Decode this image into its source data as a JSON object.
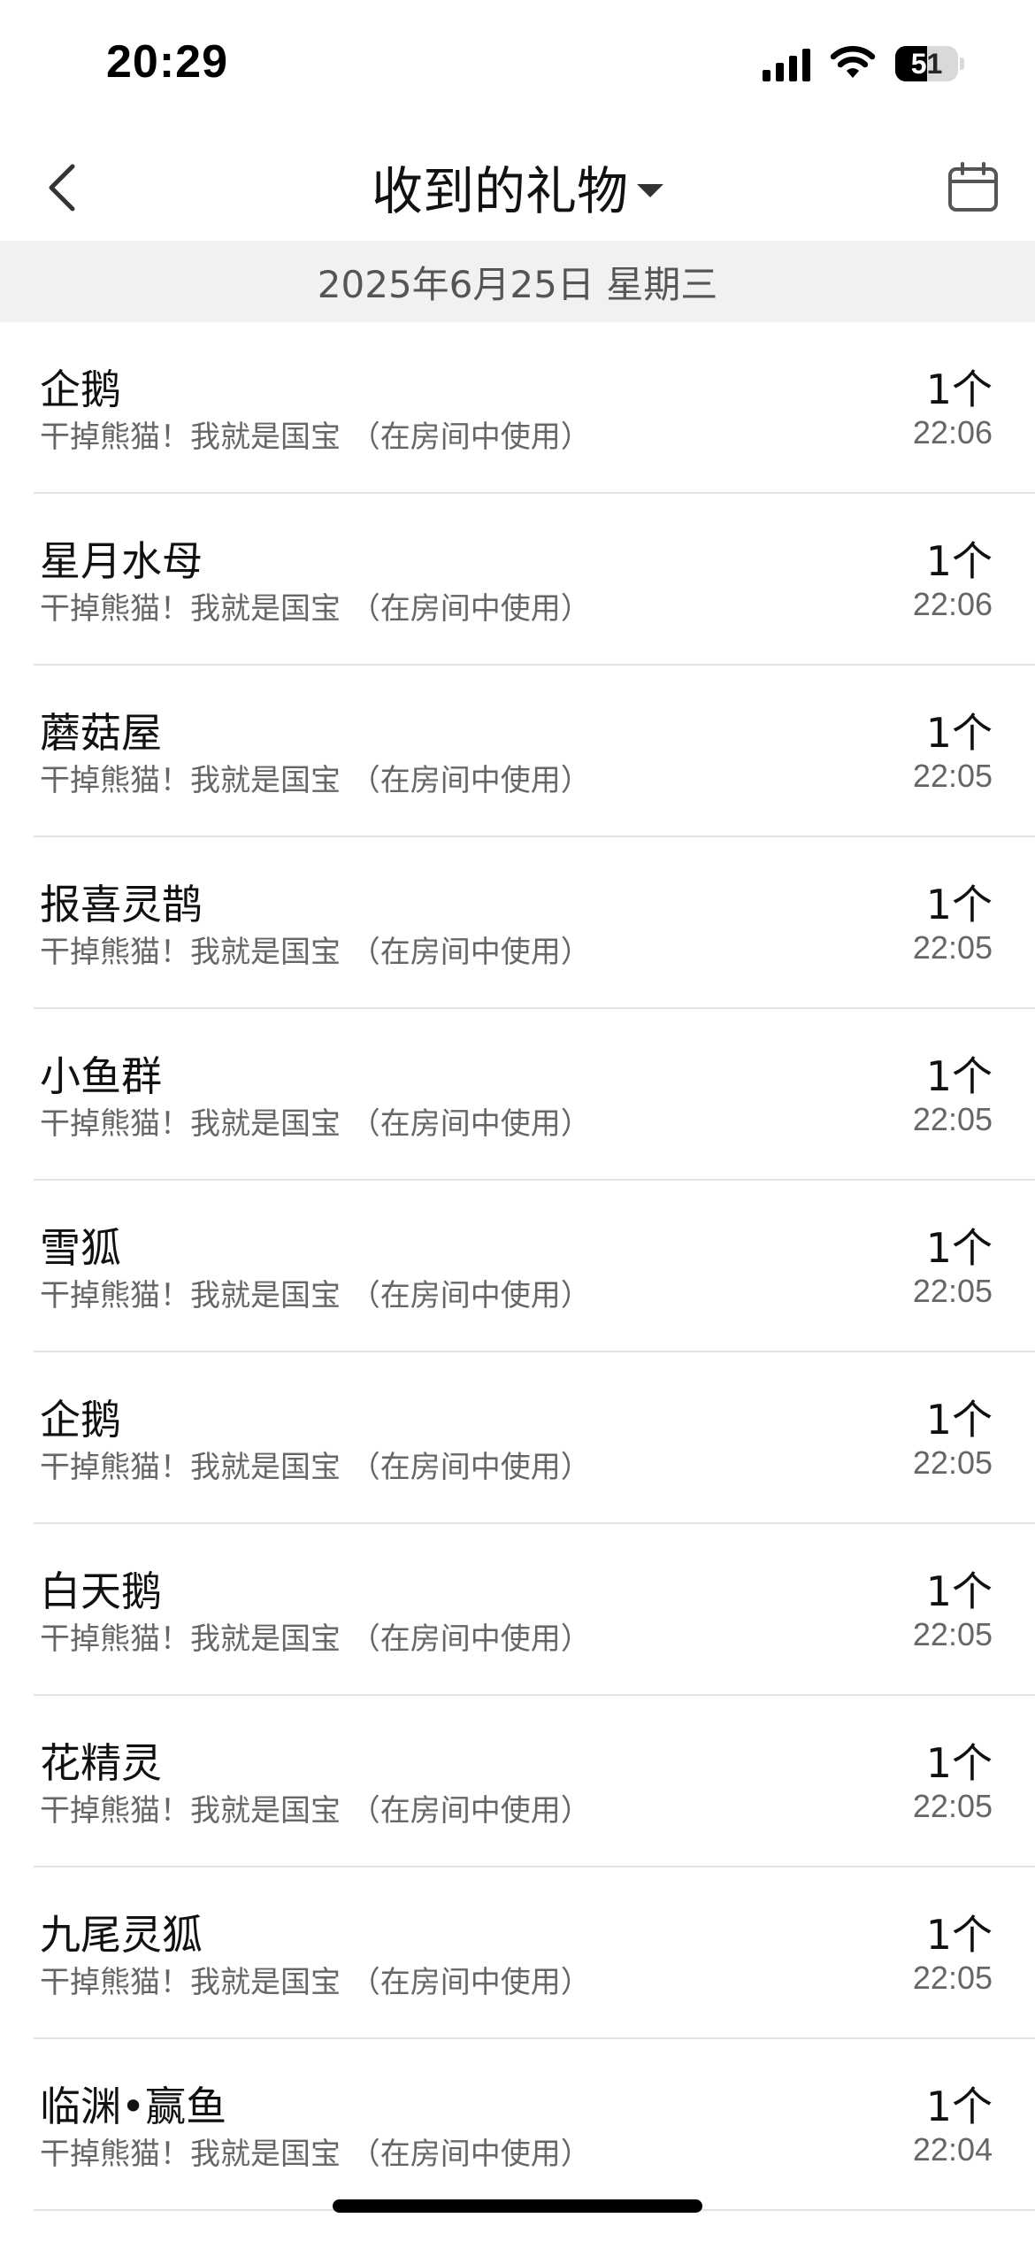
{
  "status_bar": {
    "time": "20:29",
    "battery_level": "51",
    "icons": [
      "signal-icon",
      "wifi-icon",
      "battery-icon"
    ]
  },
  "nav": {
    "title": "收到的礼物",
    "back_icon": "chevron-left-icon",
    "dropdown_icon": "caret-down-icon",
    "calendar_icon": "calendar-icon"
  },
  "date_header": "2025年6月25日 星期三",
  "gifts": [
    {
      "name": "企鹅",
      "source": "干掉熊猫！我就是国宝 （在房间中使用）",
      "count": "1个",
      "time": "22:06"
    },
    {
      "name": "星月水母",
      "source": "干掉熊猫！我就是国宝 （在房间中使用）",
      "count": "1个",
      "time": "22:06"
    },
    {
      "name": "蘑菇屋",
      "source": "干掉熊猫！我就是国宝 （在房间中使用）",
      "count": "1个",
      "time": "22:05"
    },
    {
      "name": "报喜灵鹊",
      "source": "干掉熊猫！我就是国宝 （在房间中使用）",
      "count": "1个",
      "time": "22:05"
    },
    {
      "name": "小鱼群",
      "source": "干掉熊猫！我就是国宝 （在房间中使用）",
      "count": "1个",
      "time": "22:05"
    },
    {
      "name": "雪狐",
      "source": "干掉熊猫！我就是国宝 （在房间中使用）",
      "count": "1个",
      "time": "22:05"
    },
    {
      "name": "企鹅",
      "source": "干掉熊猫！我就是国宝 （在房间中使用）",
      "count": "1个",
      "time": "22:05"
    },
    {
      "name": "白天鹅",
      "source": "干掉熊猫！我就是国宝 （在房间中使用）",
      "count": "1个",
      "time": "22:05"
    },
    {
      "name": "花精灵",
      "source": "干掉熊猫！我就是国宝 （在房间中使用）",
      "count": "1个",
      "time": "22:05"
    },
    {
      "name": "九尾灵狐",
      "source": "干掉熊猫！我就是国宝 （在房间中使用）",
      "count": "1个",
      "time": "22:05"
    },
    {
      "name": "临渊•赢鱼",
      "source": "干掉熊猫！我就是国宝 （在房间中使用）",
      "count": "1个",
      "time": "22:04"
    }
  ]
}
